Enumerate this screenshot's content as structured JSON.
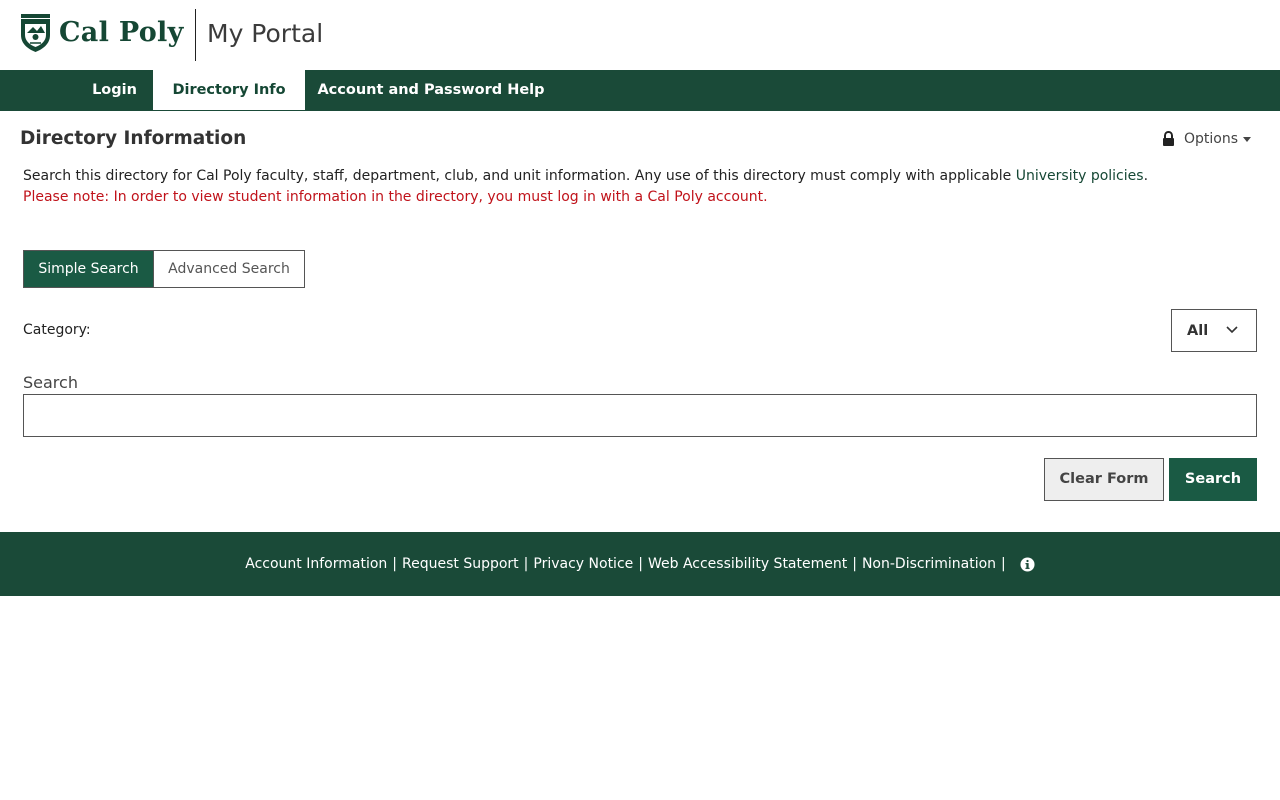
{
  "header": {
    "logo_text": "Cal Poly",
    "portal_title": "My Portal"
  },
  "nav": {
    "items": [
      {
        "label": "Login",
        "active": false
      },
      {
        "label": "Directory Info",
        "active": true
      },
      {
        "label": "Account and Password Help",
        "active": false
      }
    ]
  },
  "page": {
    "title": "Directory Information",
    "options_label": "Options",
    "intro_text": "Search this directory for Cal Poly faculty, staff, department, club, and unit information. Any use of this directory must comply with applicable ",
    "intro_link": "University policies",
    "intro_end": ".",
    "note": "Please note: In order to view student information in the directory, you must log in with a Cal Poly account."
  },
  "search": {
    "tabs": [
      {
        "label": "Simple Search",
        "active": true
      },
      {
        "label": "Advanced Search",
        "active": false
      }
    ],
    "category_label": "Category:",
    "category_value": "All",
    "search_label": "Search",
    "search_value": "",
    "search_placeholder": "",
    "clear_label": "Clear Form",
    "submit_label": "Search"
  },
  "footer": {
    "links": [
      "Account Information",
      "Request Support",
      "Privacy Notice",
      "Web Accessibility Statement",
      "Non-Discrimination"
    ],
    "separator": "|"
  },
  "colors": {
    "brand_green": "#154734",
    "nav_bg": "#1a4a38",
    "accent_green": "#1a5a44",
    "note_red": "#c0121a"
  }
}
